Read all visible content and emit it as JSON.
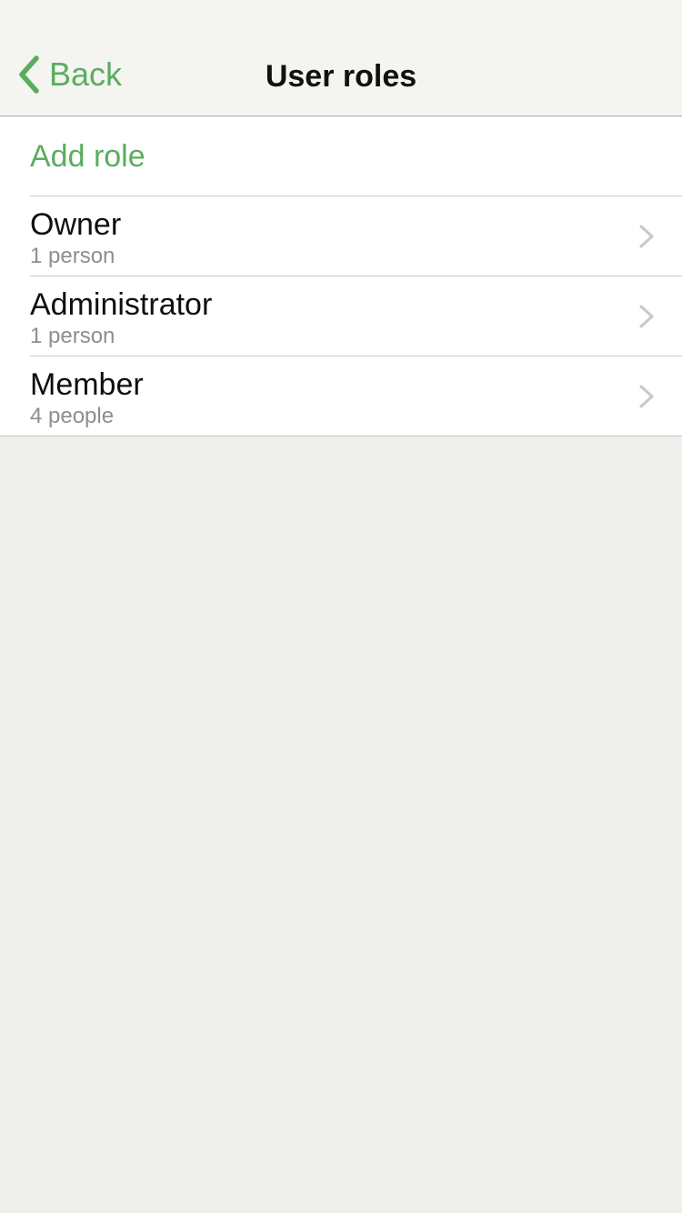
{
  "navbar": {
    "back_label": "Back",
    "title": "User roles"
  },
  "list": {
    "add_label": "Add role",
    "roles": [
      {
        "name": "Owner",
        "count": "1 person"
      },
      {
        "name": "Administrator",
        "count": "1 person"
      },
      {
        "name": "Member",
        "count": "4 people"
      }
    ]
  },
  "colors": {
    "accent": "#5aad5e",
    "background": "#efefeb",
    "navbar_background": "#f4f4f1",
    "chevron": "#c7c7cc",
    "secondary_text": "#8e8e8e"
  },
  "icons": {
    "back": "chevron-left-icon",
    "row_disclosure": "chevron-right-icon"
  }
}
